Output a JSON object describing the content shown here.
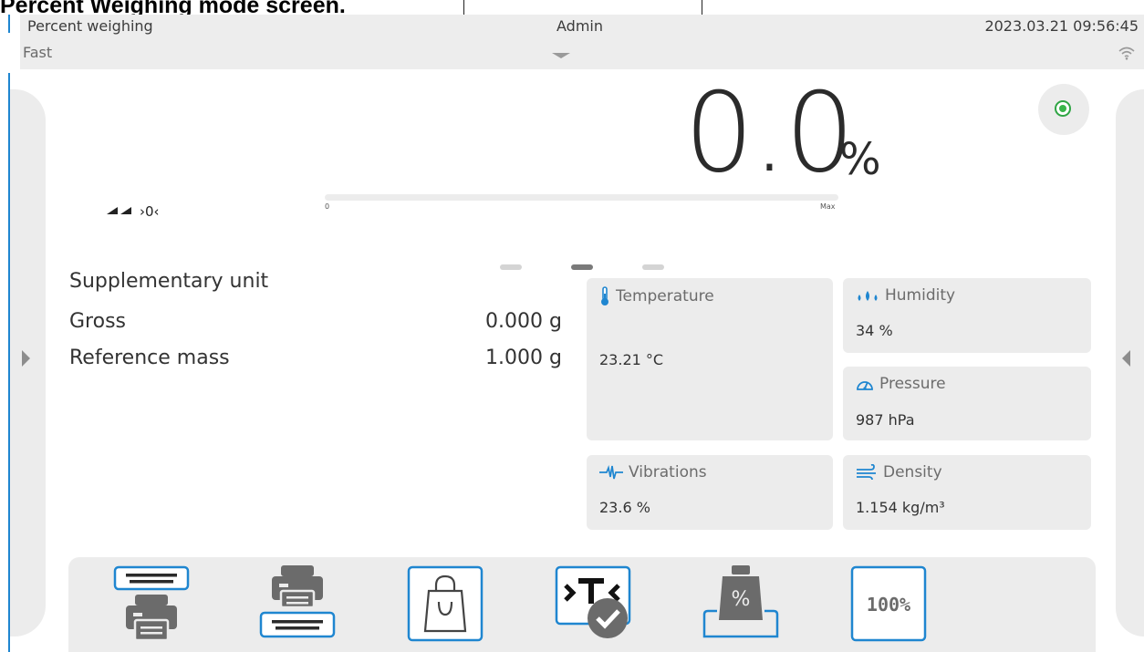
{
  "caption": "Percent Weighing mode screen.",
  "status_bar": {
    "mode": "Percent weighing",
    "submode": "Fast",
    "user": "Admin",
    "datetime": "2023.03.21 09:56:45",
    "icons": [
      "wifi-icon",
      "dropdown-arrow-icon"
    ]
  },
  "result": {
    "value": "0.0",
    "unit": "%"
  },
  "bargraph": {
    "min_label": "0",
    "max_label": "Max",
    "fill_fraction": 0
  },
  "indicators": {
    "stability_symbol": "▶◢",
    "zero_symbol": "›0‹"
  },
  "pager": {
    "pages": 3,
    "active_index": 1
  },
  "info": [
    {
      "label": "Supplementary unit",
      "value": ""
    },
    {
      "label": "Gross",
      "value": "0.000 g"
    },
    {
      "label": "Reference mass",
      "value": "1.000 g"
    }
  ],
  "tiles": {
    "temperature": {
      "title": "Temperature",
      "value": "23.21 °C",
      "icon": "thermometer-icon"
    },
    "humidity": {
      "title": "Humidity",
      "value": "34 %",
      "icon": "humidity-drops-icon"
    },
    "pressure": {
      "title": "Pressure",
      "value": "987 hPa",
      "icon": "pressure-gauge-icon"
    },
    "vibrations": {
      "title": "Vibrations",
      "value": "23.6 %",
      "icon": "vibration-icon"
    },
    "density": {
      "title": "Density",
      "value": "1.154 kg/m³",
      "icon": "wind-density-icon"
    }
  },
  "toolbar": {
    "buttons": [
      {
        "name": "print-header-button",
        "icon": "print-header-icon"
      },
      {
        "name": "print-footer-button",
        "icon": "print-footer-icon"
      },
      {
        "name": "tare-container-button",
        "icon": "shopping-bag-icon"
      },
      {
        "name": "tare-confirm-button",
        "icon": "tare-check-icon"
      },
      {
        "name": "reference-percent-button",
        "icon": "percent-weight-icon"
      },
      {
        "name": "set-100-percent-button",
        "icon": "hundred-percent-icon",
        "label": "100%"
      }
    ]
  },
  "colors": {
    "accent_blue": "#1f86d0",
    "stable_green": "#39b54a",
    "panel_gray": "#ececec",
    "icon_gray": "#6b6b6b"
  }
}
